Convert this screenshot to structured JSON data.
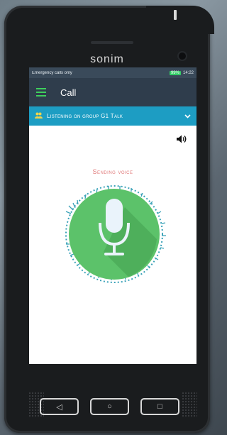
{
  "device": {
    "brand": "sonim"
  },
  "status_bar": {
    "left_text": "Emergency calls only",
    "right_text": "99%",
    "time": "14:22"
  },
  "app_bar": {
    "title": "Call"
  },
  "group_bar": {
    "label": "Listening on group G1 Talk"
  },
  "main": {
    "status_text": "Sending voice"
  },
  "icons": {
    "menu": "hamburger-menu-icon",
    "group": "people-icon",
    "expand": "chevron-down-icon",
    "speaker": "speaker-icon",
    "mic": "microphone-icon"
  },
  "colors": {
    "appbar": "#2f3d4c",
    "group_bar": "#1d9dc3",
    "mic_circle": "#5cc26a",
    "accent_green": "#3ecf5c",
    "sending_text": "#e07a7a"
  },
  "nav": {
    "back": "◁",
    "home": "○",
    "recents": "□"
  }
}
